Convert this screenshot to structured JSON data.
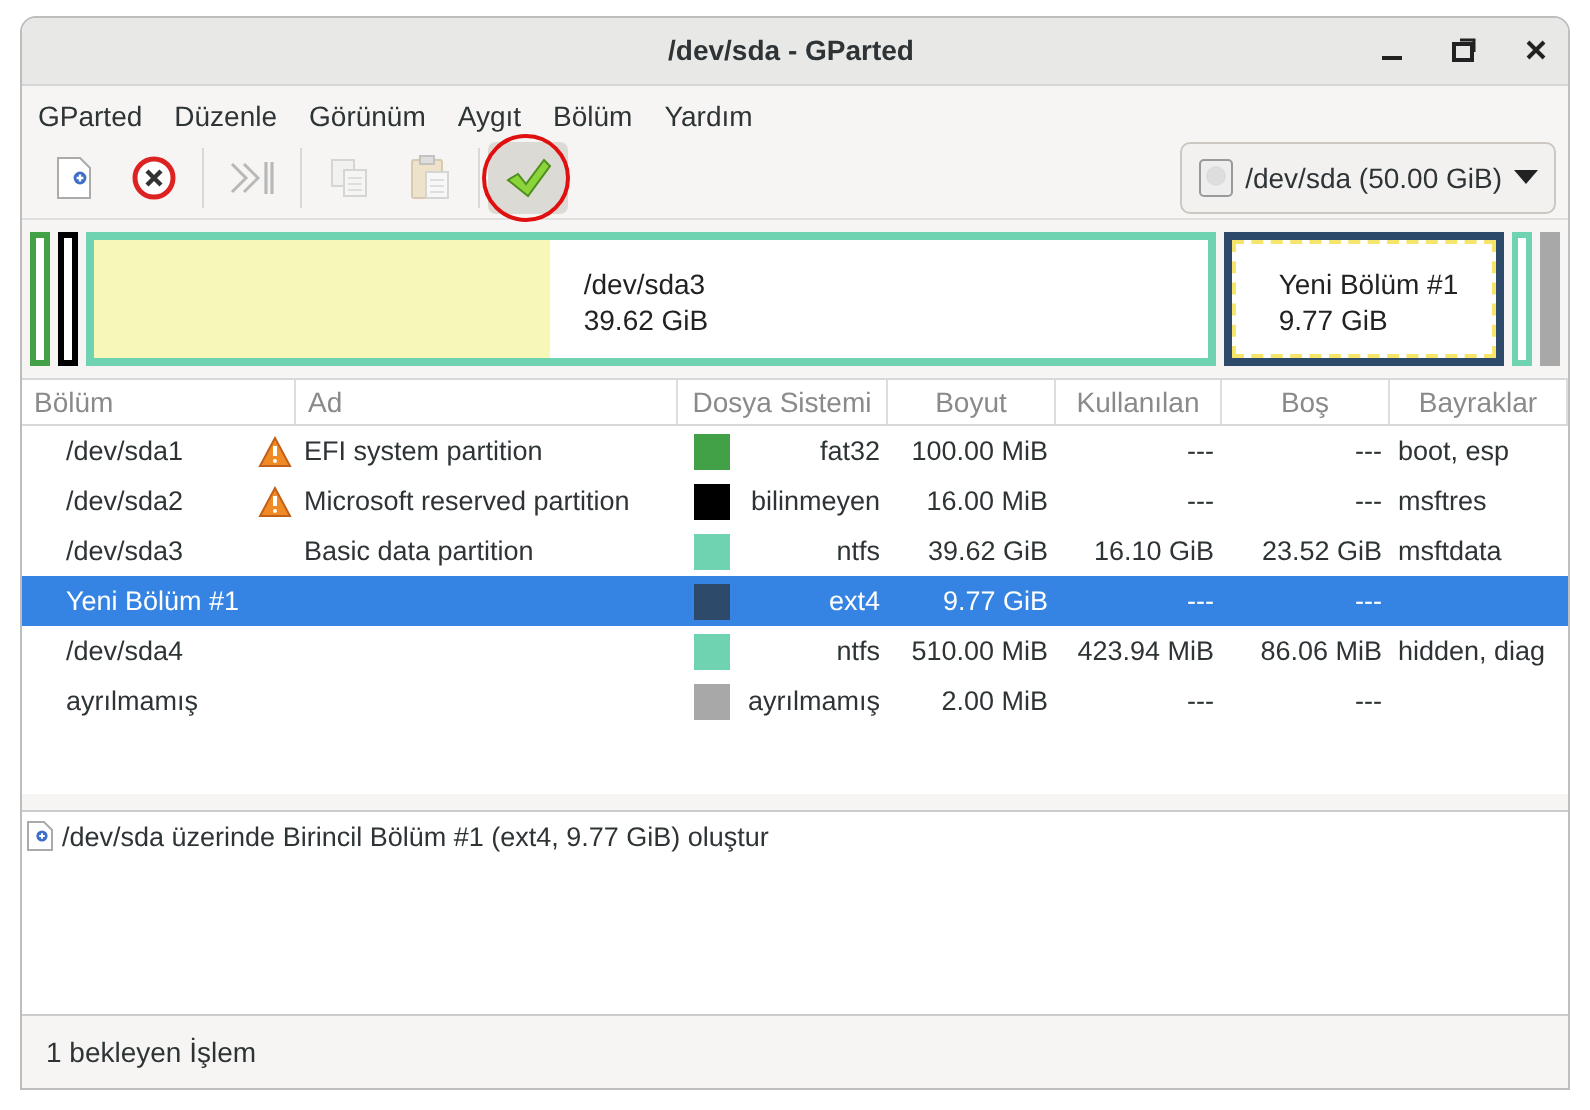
{
  "window": {
    "title": "/dev/sda - GParted"
  },
  "menu": [
    "GParted",
    "Düzenle",
    "Görünüm",
    "Aygıt",
    "Bölüm",
    "Yardım"
  ],
  "toolbar": [
    {
      "kind": "new",
      "disabled": false,
      "circled": false
    },
    {
      "kind": "delete",
      "disabled": false,
      "circled": false
    },
    {
      "kind": "resize",
      "disabled": true,
      "circled": false
    },
    {
      "kind": "copy",
      "disabled": true,
      "circled": false
    },
    {
      "kind": "paste",
      "disabled": true,
      "circled": false
    },
    {
      "kind": "apply",
      "disabled": false,
      "circled": true
    }
  ],
  "device_selector": {
    "value": "/dev/sda (50.00 GiB)"
  },
  "disk_map": [
    {
      "kind": "sliver",
      "color": "#42a047",
      "selected": false
    },
    {
      "kind": "sliver",
      "color": "#000000",
      "selected": false
    },
    {
      "kind": "block",
      "color": "#6fd2b0",
      "selected": false,
      "name": "/dev/sda3",
      "size": "39.62 GiB",
      "level": 0.41
    },
    {
      "kind": "block",
      "color": "#2e4a6b",
      "selected": true,
      "name": "Yeni Bölüm #1",
      "size": "9.77 GiB"
    },
    {
      "kind": "sliver",
      "color": "#6fd2b0",
      "selected": false
    },
    {
      "kind": "unallocated",
      "color": "#a8a8a8",
      "selected": false
    }
  ],
  "table": {
    "columns": [
      "Bölüm",
      "Ad",
      "Dosya Sistemi",
      "Boyut",
      "Kullanılan",
      "Boş",
      "Bayraklar"
    ],
    "rows": [
      {
        "partition": "/dev/sda1",
        "warning": true,
        "name": "EFI system partition",
        "color": "#42a047",
        "filesystem": "fat32",
        "size": "100.00 MiB",
        "used": "---",
        "free": "---",
        "flags": "boot, esp",
        "selected": false
      },
      {
        "partition": "/dev/sda2",
        "warning": true,
        "name": "Microsoft reserved partition",
        "color": "#000000",
        "filesystem": "bilinmeyen",
        "size": "16.00 MiB",
        "used": "---",
        "free": "---",
        "flags": "msftres",
        "selected": false
      },
      {
        "partition": "/dev/sda3",
        "warning": false,
        "name": "Basic data partition",
        "color": "#6fd2b0",
        "filesystem": "ntfs",
        "size": "39.62 GiB",
        "used": "16.10 GiB",
        "free": "23.52 GiB",
        "flags": "msftdata",
        "selected": false
      },
      {
        "partition": "Yeni Bölüm #1",
        "warning": false,
        "color": "#2e4a6b",
        "filesystem": "ext4",
        "size": "9.77 GiB",
        "used": "---",
        "free": "---",
        "selected": true
      },
      {
        "partition": "/dev/sda4",
        "warning": false,
        "color": "#6fd2b0",
        "filesystem": "ntfs",
        "size": "510.00 MiB",
        "used": "423.94 MiB",
        "free": "86.06 MiB",
        "flags": "hidden, diag",
        "selected": false
      },
      {
        "partition": "ayrılmamış",
        "warning": false,
        "color": "#a8a8a8",
        "filesystem": "ayrılmamış",
        "size": "2.00 MiB",
        "used": "---",
        "free": "---",
        "selected": false
      }
    ]
  },
  "pending_operations": [
    "/dev/sda üzerinde Birincil Bölüm #1 (ext4, 9.77 GiB) oluştur"
  ],
  "status_bar": "1 bekleyen İşlem"
}
